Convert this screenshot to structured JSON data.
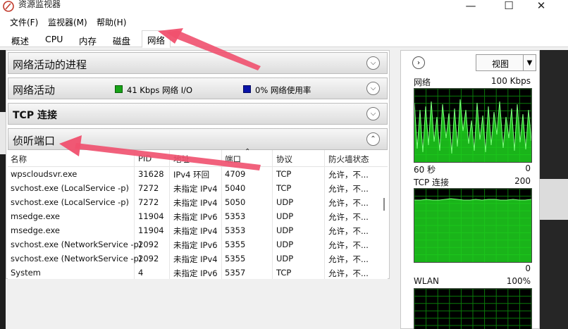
{
  "window": {
    "title": "资源监视器",
    "minimize": "—",
    "maximize": "☐",
    "close": "✕"
  },
  "menu": [
    "文件(F)",
    "监视器(M)",
    "帮助(H)"
  ],
  "tabs": [
    "概述",
    "CPU",
    "内存",
    "磁盘",
    "网络"
  ],
  "active_tab": "网络",
  "sections": {
    "processes": {
      "title": "网络活动的进程"
    },
    "activity": {
      "title": "网络活动",
      "io_label": "41 Kbps 网络 I/O",
      "usage_label": "0% 网络使用率",
      "io_color": "#17a317",
      "usage_color": "#0a14a8"
    },
    "tcp": {
      "title": "TCP 连接"
    },
    "listen": {
      "title": "侦听端口"
    }
  },
  "table": {
    "headers": [
      "名称",
      "PID",
      "地址",
      "端口",
      "协议",
      "防火墙状态"
    ],
    "rows": [
      [
        "wpscloudsvr.exe",
        "31628",
        "IPv4 环回",
        "4709",
        "TCP",
        "允许，不..."
      ],
      [
        "svchost.exe (LocalService -p)",
        "7272",
        "未指定 IPv4",
        "5040",
        "TCP",
        "允许，不..."
      ],
      [
        "svchost.exe (LocalService -p)",
        "7272",
        "未指定 IPv4",
        "5050",
        "UDP",
        "允许，不..."
      ],
      [
        "msedge.exe",
        "11904",
        "未指定 IPv6",
        "5353",
        "UDP",
        "允许，不..."
      ],
      [
        "msedge.exe",
        "11904",
        "未指定 IPv4",
        "5353",
        "UDP",
        "允许，不..."
      ],
      [
        "svchost.exe (NetworkService -p)",
        "2092",
        "未指定 IPv6",
        "5355",
        "UDP",
        "允许，不..."
      ],
      [
        "svchost.exe (NetworkService -p)",
        "2092",
        "未指定 IPv4",
        "5355",
        "UDP",
        "允许，不..."
      ],
      [
        "System",
        "4",
        "未指定 IPv6",
        "5357",
        "TCP",
        "允许，不..."
      ]
    ]
  },
  "right_panel": {
    "view_label": "视图",
    "graphs": [
      {
        "name": "网络",
        "max": "100 Kbps",
        "time": "60 秒",
        "min": "0"
      },
      {
        "name": "TCP 连接",
        "max": "200",
        "min": "0"
      },
      {
        "name": "WLAN",
        "max": "100%"
      }
    ]
  },
  "colors": {
    "graph_green": "#1fd31f",
    "graph_bg": "#000000",
    "grid": "#0a7a0a",
    "annotation_arrow": "#f0506e"
  }
}
